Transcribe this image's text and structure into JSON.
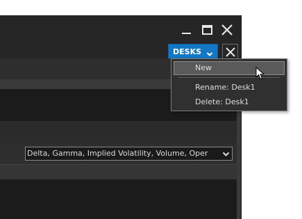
{
  "window": {
    "controls": [
      "minimize-icon",
      "maximize-icon",
      "close-icon"
    ]
  },
  "toolbar": {
    "desks_label": "DESKS",
    "desks_icon": "chevron-down-icon",
    "close_desk_icon": "close-icon",
    "accent_color": "#1477c4"
  },
  "desks_menu": {
    "items": [
      {
        "label": "New",
        "hovered": true
      },
      {
        "label": "Rename: Desk1",
        "hovered": false
      },
      {
        "label": "Delete: Desk1",
        "hovered": false
      }
    ]
  },
  "greeks_select": {
    "value": "Delta, Gamma, Implied Volatility, Volume, Oper"
  }
}
